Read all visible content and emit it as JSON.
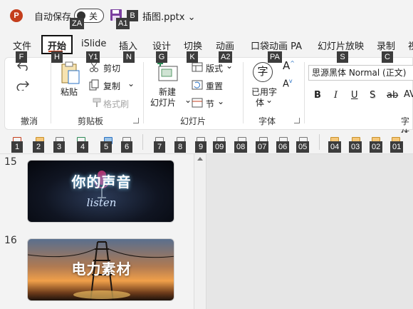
{
  "app": {
    "logo_letter": "P",
    "autosave_label": "自动保存",
    "autosave_state": "关",
    "filename": "插图.pptx",
    "filename_caret": "⌄"
  },
  "keytips": {
    "autosave": "ZA",
    "save": "A1",
    "undo_hint": "B",
    "file": "F",
    "home": "H",
    "islide": "Y1",
    "insert": "N",
    "design": "G",
    "transitions": "K",
    "animations": "A2",
    "pocket": "PA",
    "slideshow": "S",
    "record": "C",
    "qat": [
      "1",
      "2",
      "3",
      "4",
      "5",
      "6",
      "7",
      "8",
      "9",
      "09",
      "08",
      "07",
      "06",
      "05",
      "04",
      "03",
      "02",
      "01"
    ]
  },
  "tabs": [
    "文件",
    "开始",
    "iSlide",
    "插入",
    "设计",
    "切换",
    "动画",
    "口袋动画 PA",
    "幻灯片放映",
    "录制",
    "视"
  ],
  "ribbon": {
    "undo_group": "撤消",
    "clipboard": {
      "label": "剪贴板",
      "paste": "粘贴",
      "cut": "剪切",
      "copy": "复制",
      "format_painter": "格式刷"
    },
    "slides": {
      "label": "幻灯片",
      "new_slide_1": "新建",
      "new_slide_2": "幻灯片",
      "layout": "版式",
      "reset": "重置",
      "section": "节"
    },
    "font": {
      "label": "字体",
      "used_font_1": "已用字",
      "used_font_2": "体",
      "font_name": "思源黑体 Normal (正文)",
      "glyph": "字"
    },
    "font2": {
      "label": "字体"
    }
  },
  "slides": [
    {
      "number": "15",
      "title": "你的声音",
      "script": "listen"
    },
    {
      "number": "16",
      "title": "电力素材"
    }
  ]
}
